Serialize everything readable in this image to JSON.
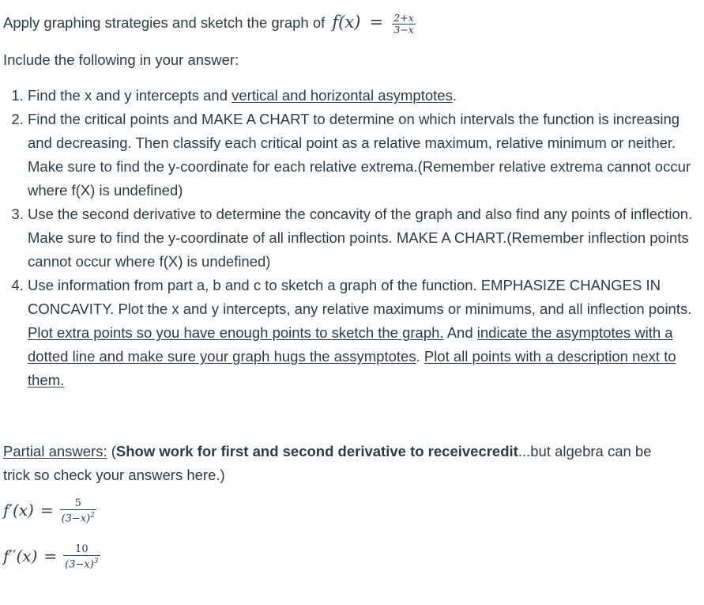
{
  "question": {
    "intro": "Apply graphing strategies and sketch the graph of",
    "function": {
      "lhs": "f(x)",
      "equals": "=",
      "numerator": "2+x",
      "denominator": "3−x"
    },
    "include_label": "Include the following in your answer:",
    "items": [
      {
        "number": "1.",
        "parts": [
          {
            "text": "Find the x and y intercepts and ",
            "underline": false
          },
          {
            "text": "vertical and horizontal asymptotes",
            "underline": true
          },
          {
            "text": ".",
            "underline": false
          }
        ]
      },
      {
        "number": "2.",
        "parts": [
          {
            "text": "Find the critical points and MAKE A CHART to determine on which intervals the function is increasing and decreasing. Then classify each critical point as a relative maximum, relative minimum or neither. Make sure to find the y-coordinate for each relative extrema.(Remember relative extrema cannot occur where f(X) is undefined)",
            "underline": false
          }
        ]
      },
      {
        "number": "3.",
        "parts": [
          {
            "text": "Use the second derivative to determine the concavity of the graph and also find any points of inflection. Make sure to find the y-coordinate of all inflection points. MAKE A CHART.(Remember inflection points cannot occur where f(X) is undefined)",
            "underline": false
          }
        ]
      },
      {
        "number": "4.",
        "parts": [
          {
            "text": "Use information from part a, b and c to sketch a graph of the function. EMPHASIZE CHANGES IN CONCAVITY. Plot the x and y intercepts, any relative maximums or minimums, and all inflection points. ",
            "underline": false
          },
          {
            "text": "Plot extra points so you have enough points to sketch the graph.",
            "underline": true
          },
          {
            "text": " And ",
            "underline": false
          },
          {
            "text": "indicate the asymptotes with a dotted line and make sure your graph hugs the assymptotes",
            "underline": true
          },
          {
            "text": ". ",
            "underline": false
          },
          {
            "text": "Plot all points with a description next to them.",
            "underline": true
          }
        ]
      }
    ]
  },
  "partial_answers": {
    "label": "Partial answers: (",
    "bold_text": "Show work for first and second derivative to receivecredit",
    "rest_text": "...but algebra can be trick so check your answers here.)",
    "first_derivative": {
      "lhs": "f′(x)",
      "equals": "=",
      "numerator": "5",
      "denominator": "(3−x)",
      "exponent": "2"
    },
    "second_derivative": {
      "lhs": "f′′(x)",
      "equals": "=",
      "numerator": "10",
      "denominator": "(3−x)",
      "exponent": "3"
    }
  }
}
